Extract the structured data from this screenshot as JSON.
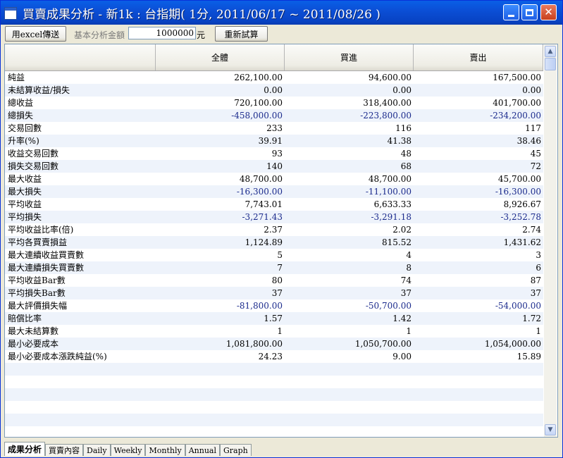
{
  "window": {
    "title": "買賣成果分析 - 新1k : 台指期( 1分, 2011/06/17 ~ 2011/08/26 )"
  },
  "toolbar": {
    "excel_label": "用excel傳送",
    "amount_label": "基本分析金額",
    "amount_value": "1000000",
    "amount_unit": "元",
    "recalc_label": "重新試算"
  },
  "columns": [
    "全體",
    "買進",
    "賣出"
  ],
  "rows": [
    {
      "label": "純益",
      "v": [
        "262,100.00",
        "94,600.00",
        "167,500.00"
      ]
    },
    {
      "label": "未結算收益/損失",
      "v": [
        "0.00",
        "0.00",
        "0.00"
      ]
    },
    {
      "label": "總收益",
      "v": [
        "720,100.00",
        "318,400.00",
        "401,700.00"
      ]
    },
    {
      "label": "總損失",
      "v": [
        "-458,000.00",
        "-223,800.00",
        "-234,200.00"
      ]
    },
    {
      "label": "交易回數",
      "v": [
        "233",
        "116",
        "117"
      ]
    },
    {
      "label": "升率(%)",
      "v": [
        "39.91",
        "41.38",
        "38.46"
      ]
    },
    {
      "label": "收益交易回數",
      "v": [
        "93",
        "48",
        "45"
      ]
    },
    {
      "label": "損失交易回數",
      "v": [
        "140",
        "68",
        "72"
      ]
    },
    {
      "label": "最大收益",
      "v": [
        "48,700.00",
        "48,700.00",
        "45,700.00"
      ]
    },
    {
      "label": "最大損失",
      "v": [
        "-16,300.00",
        "-11,100.00",
        "-16,300.00"
      ]
    },
    {
      "label": "平均收益",
      "v": [
        "7,743.01",
        "6,633.33",
        "8,926.67"
      ]
    },
    {
      "label": "平均損失",
      "v": [
        "-3,271.43",
        "-3,291.18",
        "-3,252.78"
      ]
    },
    {
      "label": "平均收益比率(倍)",
      "v": [
        "2.37",
        "2.02",
        "2.74"
      ]
    },
    {
      "label": "平均各買賣損益",
      "v": [
        "1,124.89",
        "815.52",
        "1,431.62"
      ]
    },
    {
      "label": "最大連續收益買賣數",
      "v": [
        "5",
        "4",
        "3"
      ]
    },
    {
      "label": "最大連續損失買賣數",
      "v": [
        "7",
        "8",
        "6"
      ]
    },
    {
      "label": "平均收益Bar數",
      "v": [
        "80",
        "74",
        "87"
      ]
    },
    {
      "label": "平均損失Bar數",
      "v": [
        "37",
        "37",
        "37"
      ]
    },
    {
      "label": "最大評價損失幅",
      "v": [
        "-81,800.00",
        "-50,700.00",
        "-54,000.00"
      ]
    },
    {
      "label": "賠償比率",
      "v": [
        "1.57",
        "1.42",
        "1.72"
      ]
    },
    {
      "label": "最大未結算數",
      "v": [
        "1",
        "1",
        "1"
      ]
    },
    {
      "label": "最小必要成本",
      "v": [
        "1,081,800.00",
        "1,050,700.00",
        "1,054,000.00"
      ]
    },
    {
      "label": "最小必要成本漲跌純益(%)",
      "v": [
        "24.23",
        "9.00",
        "15.89"
      ]
    },
    {
      "label": "",
      "v": [
        "",
        "",
        ""
      ]
    },
    {
      "label": "",
      "v": [
        "",
        "",
        ""
      ]
    },
    {
      "label": "",
      "v": [
        "",
        "",
        ""
      ]
    },
    {
      "label": "",
      "v": [
        "",
        "",
        ""
      ]
    },
    {
      "label": "",
      "v": [
        "",
        "",
        ""
      ]
    },
    {
      "label": "",
      "v": [
        "",
        "",
        ""
      ]
    }
  ],
  "tabs": [
    "成果分析",
    "買賣內容",
    "Daily",
    "Weekly",
    "Monthly",
    "Annual",
    "Graph"
  ],
  "active_tab": 0,
  "colors": {
    "negative": "#1a2a8c",
    "titlebar": "#0b4fd6",
    "row_alt": "#eef3fb"
  }
}
